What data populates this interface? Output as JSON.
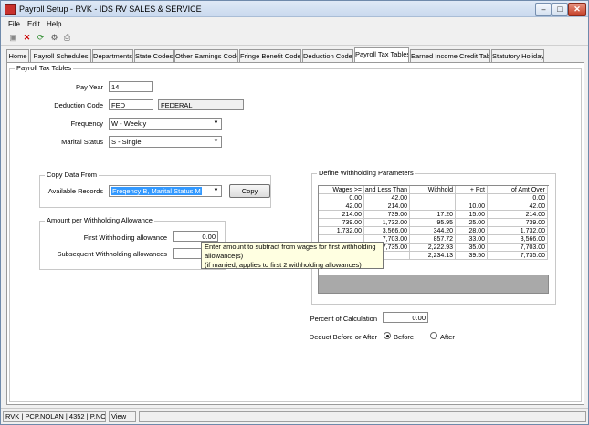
{
  "window": {
    "title": "Payroll Setup - RVK - IDS RV SALES & SERVICE",
    "min": "–",
    "max": "□",
    "close": "✕"
  },
  "menu": [
    "File",
    "Edit",
    "Help"
  ],
  "toolbar_icons": [
    "save-icon",
    "delete-icon",
    "refresh-icon",
    "settings-icon",
    "print-icon"
  ],
  "tabs": [
    "Home",
    "Payroll Schedules",
    "Departments",
    "State Codes",
    "Other Earnings Codes",
    "Fringe Benefit Codes",
    "Deduction Codes",
    "Payroll Tax Tables",
    "Earned Income Credit Table",
    "Statutory Holidays"
  ],
  "active_tab": "Payroll Tax Tables",
  "panel": {
    "title": "Payroll Tax Tables"
  },
  "form": {
    "pay_year_label": "Pay Year",
    "pay_year": "14",
    "deduction_code_label": "Deduction Code",
    "deduction_code": "FED",
    "deduction_name": "FEDERAL",
    "frequency_label": "Frequency",
    "frequency": "W - Weekly",
    "marital_status_label": "Marital Status",
    "marital_status": "S - Single"
  },
  "copy": {
    "title": "Copy Data From",
    "available_label": "Available Records",
    "available_value": "Freqency B, Marital Status M",
    "copy_button": "Copy"
  },
  "allowance": {
    "title": "Amount per Withholding Allowance",
    "first_label": "First Withholding allowance",
    "first_value": "0.00",
    "subsequent_label": "Subsequent Withholding allowances",
    "subsequent_value": ""
  },
  "tooltip": {
    "line1": "Enter amount to subtract from wages for first withholding",
    "line2": "allowance(s)",
    "line3": "(if married, applies to first 2 withholding allowances)"
  },
  "withholding": {
    "title": "Define Withholding Parameters",
    "headers": [
      "Wages >=",
      "and Less Than",
      "Withhold",
      "+ Pct",
      "of Amt Over"
    ],
    "rows": [
      [
        "0.00",
        "42.00",
        "",
        "",
        "0.00"
      ],
      [
        "42.00",
        "214.00",
        "",
        "10.00",
        "42.00"
      ],
      [
        "214.00",
        "739.00",
        "17.20",
        "15.00",
        "214.00"
      ],
      [
        "739.00",
        "1,732.00",
        "95.95",
        "25.00",
        "739.00"
      ],
      [
        "1,732.00",
        "3,566.00",
        "344.20",
        "28.00",
        "1,732.00"
      ],
      [
        "",
        "7,703.00",
        "857.72",
        "33.00",
        "3,566.00"
      ],
      [
        "",
        "7,735.00",
        "2,222.93",
        "35.00",
        "7,703.00"
      ],
      [
        "",
        "",
        "2,234.13",
        "39.50",
        "7,735.00"
      ]
    ]
  },
  "calc": {
    "percent_label": "Percent of Calculation",
    "percent_value": "0.00",
    "deduct_label": "Deduct Before or After",
    "before_label": "Before",
    "after_label": "After"
  },
  "status": [
    "RVK | PCP.NOLAN | 4352 | P.NOLAN",
    "View"
  ]
}
